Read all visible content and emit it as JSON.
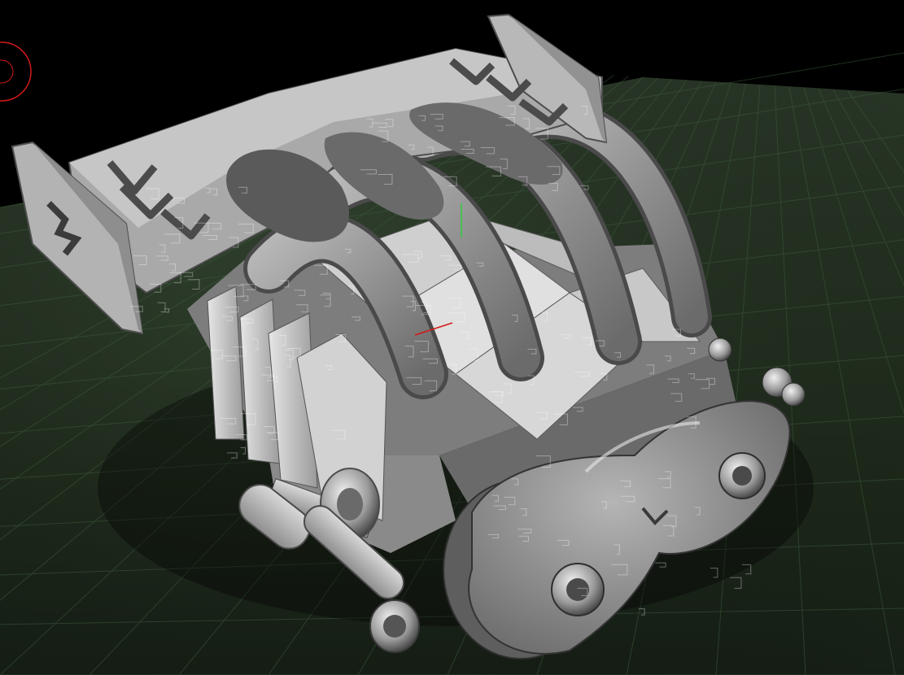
{
  "scene": {
    "background_color": "#000000",
    "floor_color": "#22301f",
    "grid_line_color": "#3c5a3c",
    "model_base_color": "#9c9c9c",
    "gizmo": {
      "y_axis_color": "#2ecc40",
      "x_axis_color": "#d11a1a",
      "corner_marker_color": "#d11a1a"
    },
    "icons": [
      "viewport-rotate-gizmo",
      "axis-gizmo"
    ]
  }
}
